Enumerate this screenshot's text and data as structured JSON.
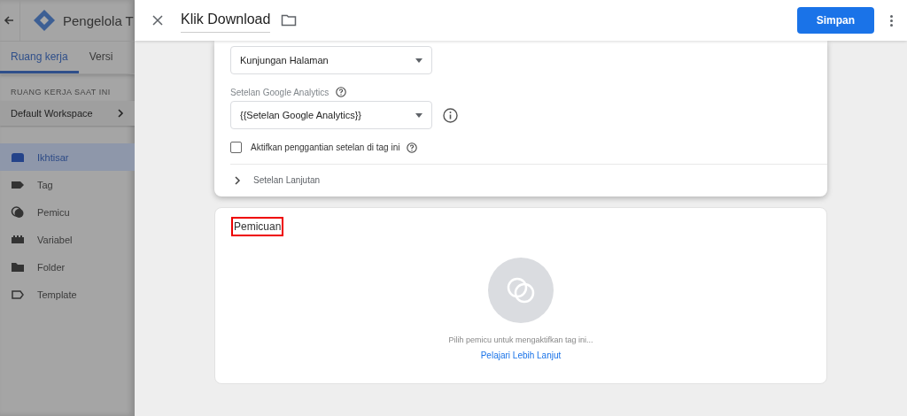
{
  "app": {
    "title": "Pengelola T",
    "tabs": [
      {
        "label": "Ruang kerja",
        "selected": true
      },
      {
        "label": "Versi",
        "selected": false
      }
    ],
    "workspace_label": "RUANG KERJA SAAT INI",
    "workspace": "Default Workspace",
    "nav": [
      {
        "label": "Ikhtisar",
        "selected": true
      },
      {
        "label": "Tag",
        "selected": false
      },
      {
        "label": "Pemicu",
        "selected": false
      },
      {
        "label": "Variabel",
        "selected": false
      },
      {
        "label": "Folder",
        "selected": false
      },
      {
        "label": "Template",
        "selected": false
      }
    ]
  },
  "editor": {
    "title": "Klik Download",
    "save": "Simpan",
    "tracking_type": {
      "value": "Kunjungan Halaman"
    },
    "ga_settings": {
      "label": "Setelan Google Analytics",
      "value": "{{Setelan Google Analytics}}"
    },
    "override": {
      "label": "Aktifkan penggantian setelan di tag ini",
      "checked": false
    },
    "advanced": {
      "label": "Setelan Lanjutan",
      "expanded": false
    },
    "triggering": {
      "title": "Pemicuan",
      "highlighted": true,
      "hint": "Pilih pemicu untuk mengaktifkan tag ini...",
      "link": "Pelajari Lebih Lanjut"
    }
  }
}
